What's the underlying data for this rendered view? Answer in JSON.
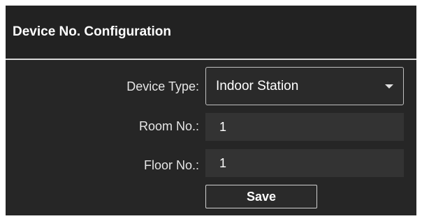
{
  "section": {
    "title": "Device No. Configuration"
  },
  "form": {
    "device_type": {
      "label": "Device Type:",
      "value": "Indoor Station"
    },
    "room_no": {
      "label": "Room No.:",
      "value": "1"
    },
    "floor_no": {
      "label": "Floor No.:",
      "value": "1"
    },
    "save_label": "Save"
  }
}
